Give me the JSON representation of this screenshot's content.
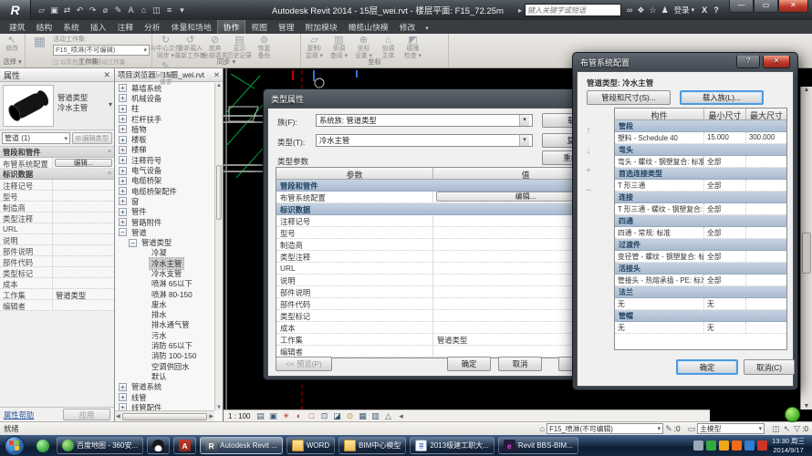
{
  "titlebar": {
    "title": "Autodesk Revit 2014 -   15层_wei.rvt - 楼层平面: F15_72.25m",
    "search_placeholder": "键入关键字或短语",
    "login": "登录",
    "exchange": "X",
    "help": "?",
    "window": {
      "min": "—",
      "restore": "▭",
      "close": "✕"
    },
    "quick_icons": [
      {
        "name": "open-icon",
        "g": "▱"
      },
      {
        "name": "save-icon",
        "g": "▣"
      },
      {
        "name": "sync-with-central-icon",
        "g": "⇄"
      },
      {
        "name": "undo-icon",
        "g": "↶"
      },
      {
        "name": "redo-icon",
        "g": "↷"
      },
      {
        "name": "measure-icon",
        "g": "⌀"
      },
      {
        "name": "tag-icon",
        "g": "✎"
      },
      {
        "name": "text-icon",
        "g": "A"
      },
      {
        "name": "default-3d-view-icon",
        "g": "⌂"
      },
      {
        "name": "section-icon",
        "g": "◫"
      },
      {
        "name": "thin-lines-icon",
        "g": "≡"
      },
      {
        "name": "customize-qat-icon",
        "g": "▾"
      }
    ],
    "info_icons": [
      {
        "name": "search-binoculars-icon",
        "g": "∞"
      },
      {
        "name": "subscription-center-icon",
        "g": "❖"
      },
      {
        "name": "favorites-star-icon",
        "g": "☆"
      },
      {
        "name": "signin-person-icon",
        "g": "♟"
      }
    ]
  },
  "ribbon": {
    "tabs": [
      "建筑",
      "结构",
      "系统",
      "插入",
      "注释",
      "分析",
      "体量和场地",
      "协作",
      "视图",
      "管理",
      "附加模块",
      "橄榄山快模",
      "修改"
    ],
    "active_tab": "协作",
    "tab_extra": "▾",
    "select_panel": {
      "modify_label": "修改",
      "icon": "↖",
      "panel_label": "选择 ▾"
    },
    "workset_panel": {
      "active_label": "活动工作集:",
      "workset_value": "F15_喷淋(不可编辑)",
      "gray_label": "以灰色显示非活动工作集",
      "workset_btn": "工作集",
      "panel_label": "工作集"
    },
    "sync_panel": {
      "panel_label": "同步 ▾",
      "buttons": [
        {
          "name": "sync-with-central-button",
          "g": "↻",
          "lines": [
            "与中心文件",
            "同步"
          ],
          "caret": true
        },
        {
          "name": "reload-latest-button",
          "g": "↺",
          "lines": [
            "重新载入",
            "最新工作集"
          ]
        },
        {
          "name": "relinquish-all-button",
          "g": "⊘",
          "lines": [
            "放弃",
            "全部请求"
          ]
        },
        {
          "name": "show-history-button",
          "g": "▤",
          "lines": [
            "显示",
            "历史记录"
          ]
        },
        {
          "name": "restore-backup-button",
          "g": "⊚",
          "lines": [
            "恢复",
            "备份"
          ]
        },
        {
          "name": "editing-requests-button",
          "g": "✎",
          "lines": [
            "正在编辑",
            "请求"
          ]
        }
      ]
    },
    "coord_panel": {
      "panel_label": "坐标",
      "buttons": [
        {
          "name": "copy-monitor-button",
          "g": "▱",
          "lines": [
            "复制/",
            "监视"
          ],
          "caret": true
        },
        {
          "name": "coordination-review-button",
          "g": "▥",
          "lines": [
            "协调",
            "查阅"
          ],
          "caret": true
        },
        {
          "name": "coordination-settings-button",
          "g": "⊕",
          "lines": [
            "坐标",
            "设置"
          ],
          "caret": true
        },
        {
          "name": "coordination-host-button",
          "g": "⌂",
          "lines": [
            "协调",
            "主体"
          ]
        },
        {
          "name": "interference-check-button",
          "g": "◩",
          "lines": [
            "碰撞",
            "检查"
          ],
          "caret": true
        }
      ]
    }
  },
  "props": {
    "header": "属性",
    "close": "✕",
    "preview_type": "管道类型",
    "preview_name": "冷水主管",
    "selector": "管道 (1)",
    "edit_type_btn": "编辑类型",
    "section_pipe": "管段和管件",
    "section_pin": "^",
    "routing_row_label": "布管系统配置",
    "routing_row_btn": "编辑...",
    "section_identity": "标识数据",
    "identity_rows": [
      {
        "l": "注释记号",
        "v": ""
      },
      {
        "l": "型号",
        "v": ""
      },
      {
        "l": "制造商",
        "v": ""
      },
      {
        "l": "类型注释",
        "v": ""
      },
      {
        "l": "URL",
        "v": ""
      },
      {
        "l": "说明",
        "v": ""
      },
      {
        "l": "部件说明",
        "v": ""
      },
      {
        "l": "部件代码",
        "v": ""
      },
      {
        "l": "类型标记",
        "v": ""
      },
      {
        "l": "成本",
        "v": ""
      },
      {
        "l": "工作集",
        "v": "管道类型"
      },
      {
        "l": "编辑者",
        "v": ""
      }
    ],
    "help_link": "属性帮助",
    "apply_btn": "应用"
  },
  "browser": {
    "title": "项目浏览器 - 15层_wei.rvt",
    "close": "✕",
    "items": [
      {
        "label": "幕墙系统",
        "state": "+",
        "depth": 0
      },
      {
        "label": "机械设备",
        "state": "+",
        "depth": 0
      },
      {
        "label": "柱",
        "state": "+",
        "depth": 0
      },
      {
        "label": "栏杆扶手",
        "state": "+",
        "depth": 0
      },
      {
        "label": "植物",
        "state": "+",
        "depth": 0
      },
      {
        "label": "楼板",
        "state": "+",
        "depth": 0
      },
      {
        "label": "楼梯",
        "state": "+",
        "depth": 0
      },
      {
        "label": "注释符号",
        "state": "+",
        "depth": 0
      },
      {
        "label": "电气设备",
        "state": "+",
        "depth": 0
      },
      {
        "label": "电缆桥架",
        "state": "+",
        "depth": 0
      },
      {
        "label": "电缆桥架配件",
        "state": "+",
        "depth": 0
      },
      {
        "label": "窗",
        "state": "+",
        "depth": 0
      },
      {
        "label": "管件",
        "state": "+",
        "depth": 0
      },
      {
        "label": "管路附件",
        "state": "+",
        "depth": 0
      },
      {
        "label": "管道",
        "state": "-",
        "depth": 0
      },
      {
        "label": "管道类型",
        "state": "-",
        "depth": 1
      },
      {
        "label": "冷凝",
        "state": "",
        "depth": 2
      },
      {
        "label": "冷水主管",
        "state": "",
        "depth": 2,
        "selected": true
      },
      {
        "label": "冷水支管",
        "state": "",
        "depth": 2
      },
      {
        "label": "喷淋 65以下",
        "state": "",
        "depth": 2
      },
      {
        "label": "喷淋 80-150",
        "state": "",
        "depth": 2
      },
      {
        "label": "废水",
        "state": "",
        "depth": 2
      },
      {
        "label": "排水",
        "state": "",
        "depth": 2
      },
      {
        "label": "排水通气管",
        "state": "",
        "depth": 2
      },
      {
        "label": "污水",
        "state": "",
        "depth": 2
      },
      {
        "label": "消防 65以下",
        "state": "",
        "depth": 2
      },
      {
        "label": "消防 100-150",
        "state": "",
        "depth": 2
      },
      {
        "label": "空调供回水",
        "state": "",
        "depth": 2
      },
      {
        "label": "默认",
        "state": "",
        "depth": 2
      },
      {
        "label": "管道系统",
        "state": "+",
        "depth": 0
      },
      {
        "label": "线管",
        "state": "+",
        "depth": 0
      },
      {
        "label": "线管配件",
        "state": "+",
        "depth": 0
      }
    ]
  },
  "type_dialog": {
    "title": "类型属性",
    "family_label": "族(F):",
    "family_value": "系统族: 管道类型",
    "load_btn": "载入(L)...",
    "type_label": "类型(T):",
    "type_value": "冷水主管",
    "duplicate_btn": "复制(D)...",
    "rename_btn": "重命名(R)...",
    "params_label": "类型参数",
    "col_param": "参数",
    "col_value": "值",
    "rows": [
      {
        "group": "管段和管件"
      },
      {
        "param": "布管系统配置",
        "btn": "编辑..."
      },
      {
        "group": "标识数据"
      },
      {
        "param": "注释记号"
      },
      {
        "param": "型号"
      },
      {
        "param": "制造商"
      },
      {
        "param": "类型注释"
      },
      {
        "param": "URL"
      },
      {
        "param": "说明"
      },
      {
        "param": "部件说明"
      },
      {
        "param": "部件代码"
      },
      {
        "param": "类型标记"
      },
      {
        "param": "成本"
      },
      {
        "param": "工作集",
        "value": "管道类型"
      },
      {
        "param": "编辑者"
      }
    ],
    "preview_btn": "<< 预览(P)",
    "ok_btn": "确定",
    "cancel_btn": "取消",
    "apply_btn": "应用"
  },
  "routing_dialog": {
    "title": "布管系统配置",
    "help": "?",
    "close": "✕",
    "pipe_type_label": "管道类型: 冷水主管",
    "segments_btn": "管段和尺寸(S)...",
    "load_family_btn": "载入族(L)...",
    "col_component": "构件",
    "col_min": "最小尺寸",
    "col_max": "最大尺寸",
    "side_icons": [
      {
        "name": "move-row-up-icon",
        "g": "↑"
      },
      {
        "name": "move-row-down-icon",
        "g": "↓"
      },
      {
        "name": "add-row-icon",
        "g": "+"
      },
      {
        "name": "remove-row-icon",
        "g": "−"
      }
    ],
    "rows": [
      {
        "group": "管段"
      },
      {
        "c": "塑料 - Schedule 40",
        "min": "15.000",
        "max": "300.000"
      },
      {
        "group": "弯头"
      },
      {
        "c": "弯头 - 螺纹 - 钢塑复合: 标准",
        "min": "全部",
        "max": ""
      },
      {
        "group": "首选连接类型"
      },
      {
        "c": "T 形三通",
        "min": "全部",
        "max": ""
      },
      {
        "group": "连接"
      },
      {
        "c": "T 形三通 - 螺纹 - 钢塑复合: 标",
        "min": "全部",
        "max": ""
      },
      {
        "group": "四通"
      },
      {
        "c": "四通 - 常规: 标准",
        "min": "全部",
        "max": ""
      },
      {
        "group": "过渡件"
      },
      {
        "c": "变径管 - 螺纹 - 钢塑复合: 标准",
        "min": "全部",
        "max": ""
      },
      {
        "group": "活接头"
      },
      {
        "c": "管接头 - 热熔承插 - PE: 标准",
        "min": "全部",
        "max": ""
      },
      {
        "group": "法兰"
      },
      {
        "c": "无",
        "min": "无",
        "max": ""
      },
      {
        "group": "管帽"
      },
      {
        "c": "无",
        "min": "无",
        "max": ""
      }
    ],
    "ok_btn": "确定",
    "cancel_btn": "取消(C)"
  },
  "viewbar": {
    "scale": "1 : 100",
    "icons": [
      {
        "name": "detail-level-icon",
        "g": "▤",
        "c": "#3c5a74"
      },
      {
        "name": "visual-style-icon",
        "g": "▣",
        "c": "#3c5a74"
      },
      {
        "name": "sun-path-icon",
        "g": "☀",
        "c": "#b5432e"
      },
      {
        "name": "shadows-icon",
        "g": "◐",
        "c": "#b5432e"
      },
      {
        "name": "crop-view-icon",
        "g": "□",
        "c": "#b5432e"
      },
      {
        "name": "show-crop-region-icon",
        "g": "⊡",
        "c": "#3c5a74"
      },
      {
        "name": "temporary-hide-isolate-icon",
        "g": "◪",
        "c": "#3c5a74"
      },
      {
        "name": "reveal-hidden-elements-icon",
        "g": "⊙",
        "c": "#b08a1e"
      },
      {
        "name": "worksharing-display-icon",
        "g": "▦",
        "c": "#3c5a74"
      },
      {
        "name": "temporary-view-properties-icon",
        "g": "▥",
        "c": "#3c5a74"
      },
      {
        "name": "analytical-model-icon",
        "g": "△",
        "c": "#3c5a74"
      },
      {
        "name": "expand-viewbar-icon",
        "g": "◂",
        "c": "#666666"
      }
    ]
  },
  "statusbar": {
    "ready": "就绪",
    "workset": "F15_喷淋(不可编辑)",
    "edit_icon": "✎",
    "edit_count": ":0",
    "design_option_icon": "▭",
    "main_model": "主模型",
    "right_icons": [
      {
        "name": "worksharing-status-icon",
        "g": "◫"
      },
      {
        "name": "select-toggle-icon",
        "g": "↖"
      },
      {
        "name": "filter-icon",
        "g": "▽"
      }
    ],
    "filter_count": ":0"
  },
  "taskbar": {
    "tasks": [
      {
        "name": "task-baidu-map",
        "label": "百度地图 - 360安...",
        "icon": "i360",
        "letter": ""
      },
      {
        "name": "task-qq",
        "label": "",
        "icon": "iqq",
        "letter": ""
      },
      {
        "name": "task-autocad",
        "label": "",
        "icon": "iacad",
        "letter": "A"
      },
      {
        "name": "task-revit",
        "label": "Autodesk Revit ...",
        "icon": "irevit",
        "letter": "R",
        "active": true
      },
      {
        "name": "task-word-folder",
        "label": "WORD",
        "icon": "ifolder",
        "letter": ""
      },
      {
        "name": "task-bim-folder",
        "label": "BIM中心模型",
        "icon": "ifolder",
        "letter": ""
      },
      {
        "name": "task-doc-2013",
        "label": "2013级建工职大...",
        "icon": "idoc",
        "letter": "≣"
      },
      {
        "name": "task-revit-bbs",
        "label": "Revit BBS-BIM...",
        "icon": "ire",
        "letter": "e"
      }
    ],
    "tray": [
      {
        "name": "ime-icon",
        "color": "#9aa7b8"
      },
      {
        "name": "antivirus-shield-icon",
        "color": "#36a93c"
      },
      {
        "name": "browser-360-tray-icon",
        "color": "#f0a418"
      },
      {
        "name": "sogou-tray-icon",
        "color": "#f06a18"
      },
      {
        "name": "sync-tray-icon",
        "color": "#2f7fd4"
      },
      {
        "name": "phone-tray-icon",
        "color": "#d03427"
      }
    ],
    "clock_time": "13:30 周三",
    "clock_date": "2014/9/17"
  }
}
